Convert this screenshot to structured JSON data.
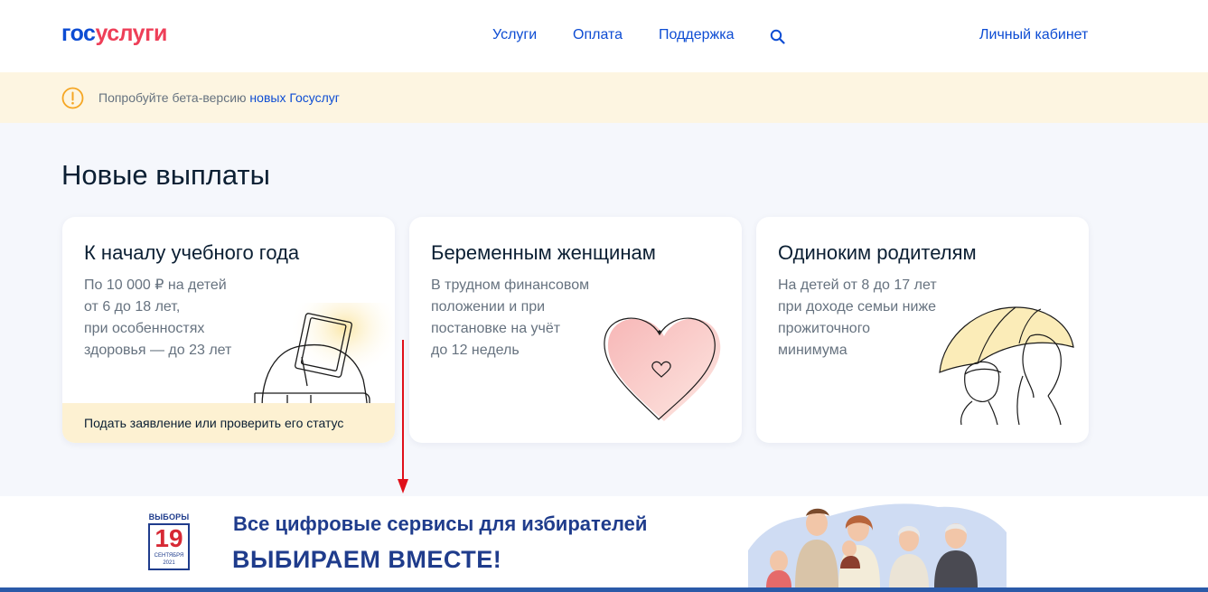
{
  "header": {
    "logo_part1": "гос",
    "logo_part2": "услуги",
    "nav": [
      {
        "label": "Услуги"
      },
      {
        "label": "Оплата"
      },
      {
        "label": "Поддержка"
      }
    ],
    "account_label": "Личный кабинет"
  },
  "beta": {
    "text": "Попробуйте бета-версию ",
    "link": "новых Госуслуг"
  },
  "main": {
    "title": "Новые выплаты",
    "cards": [
      {
        "title": "К началу учебного года",
        "lines": [
          "По 10 000 ₽ на детей",
          "от 6 до 18 лет,",
          "при особенностях",
          "здоровья — до 23 лет"
        ],
        "footer": "Подать заявление или проверить его статус"
      },
      {
        "title": "Беременным женщинам",
        "lines": [
          "В трудном финансовом",
          "положении и при",
          "постановке на учёт",
          "до 12 недель"
        ]
      },
      {
        "title": "Одиноким родителям",
        "lines": [
          "На детей от 8 до 17 лет",
          "при доходе семьи ниже",
          "прожиточного",
          "минимума"
        ]
      }
    ]
  },
  "election": {
    "cal_top": "ВЫБОРЫ",
    "cal_day": "19",
    "cal_month": "СЕНТЯБРЯ",
    "cal_year": "2021",
    "line1": "Все цифровые сервисы для избирателей",
    "line2": "ВЫБИРАЕМ ВМЕСТЕ!"
  },
  "colors": {
    "brand_blue": "#0d4cd3",
    "brand_red": "#ee3f58",
    "banner_bg": "#fdf5e1",
    "card_footer_bg": "#fdf1d2",
    "election_blue": "#1f3c8c",
    "arrow_red": "#e0101a"
  },
  "icons": [
    "search-icon",
    "warning-icon",
    "backpack-illustration",
    "heart-illustration",
    "umbrella-illustration",
    "family-illustration"
  ]
}
